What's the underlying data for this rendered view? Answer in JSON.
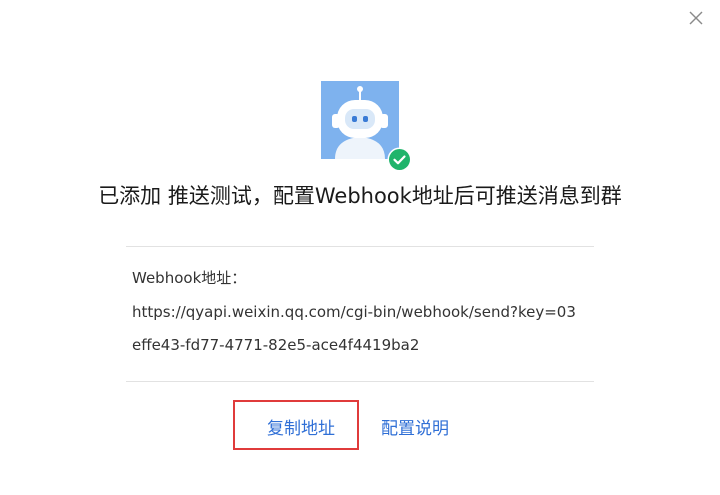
{
  "dialog": {
    "close_icon": "close-icon",
    "avatar_icon": "robot-icon",
    "badge_icon": "check-circle-icon",
    "title": "已添加 推送测试，配置Webhook地址后可推送消息到群",
    "webhook": {
      "label": "Webhook地址：",
      "url_line1": "https://qyapi.weixin.qq.com/cgi-bin/webhook/send?key=03",
      "url_line2": "effe43-fd77-4771-82e5-ace4f4419ba2"
    },
    "actions": {
      "copy_label": "复制地址",
      "help_label": "配置说明"
    }
  },
  "colors": {
    "accent_link": "#2f6fd6",
    "success_badge": "#1fb46b",
    "avatar_bg": "#7eb2ee",
    "highlight_border": "#e03b3b"
  }
}
